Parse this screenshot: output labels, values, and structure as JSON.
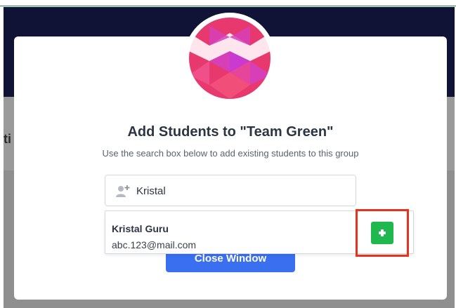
{
  "background": {
    "partial_text": "ti"
  },
  "modal": {
    "title": "Add Students to \"Team Green\"",
    "subtitle": "Use the search box below to add existing students to this group",
    "search": {
      "value": "Kristal",
      "icon": "add-user-icon"
    },
    "results": [
      {
        "name": "Kristal Guru",
        "email": "abc.123@mail.com",
        "action_icon": "plus-icon"
      }
    ],
    "close_label": "Close Window"
  },
  "colors": {
    "header_bg": "#101236",
    "overlay": "#8f8f8f",
    "title": "#2d3443",
    "primary_button": "#3a6ff0",
    "add_button": "#1fb84f",
    "highlight": "#e8321e",
    "avatar_pink": "#e8396f",
    "avatar_magenta": "#d63fb8"
  }
}
